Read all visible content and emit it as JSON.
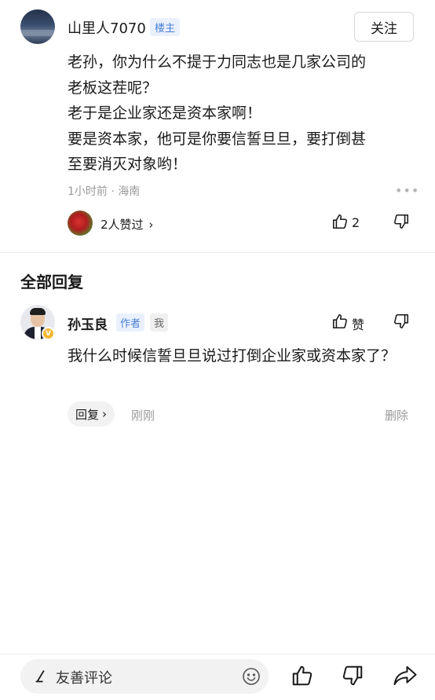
{
  "comment": {
    "username": "山里人7070",
    "op_badge": "楼主",
    "follow_label": "关注",
    "lines": [
      "老孙，你为什么不提于力同志也是几家公司的",
      "老板这茬呢？",
      "老于是企业家还是资本家啊！",
      "要是资本家，他可是你要信誓旦旦，要打倒甚",
      "至要消灭对象哟！"
    ],
    "meta": "1小时前 · 海南",
    "more_icon": "more-dots-icon",
    "likers_text": "2人赞过",
    "like_count": "2"
  },
  "section": {
    "title": "全部回复"
  },
  "reply": {
    "username": "孙玉良",
    "author_badge": "作者",
    "me_badge": "我",
    "verified_badge": "V",
    "like_label": "赞",
    "text": "我什么时候信誓旦旦说过打倒企业家或资本家了？",
    "reply_button": "回复",
    "time": "刚刚",
    "delete_label": "删除"
  },
  "bottom_bar": {
    "placeholder": "友善评论"
  },
  "colors": {
    "badge_text": "#4a7fd8",
    "badge_bg": "#eaf1fd",
    "muted_text": "#9a9a9a",
    "verified": "#f5b731"
  }
}
